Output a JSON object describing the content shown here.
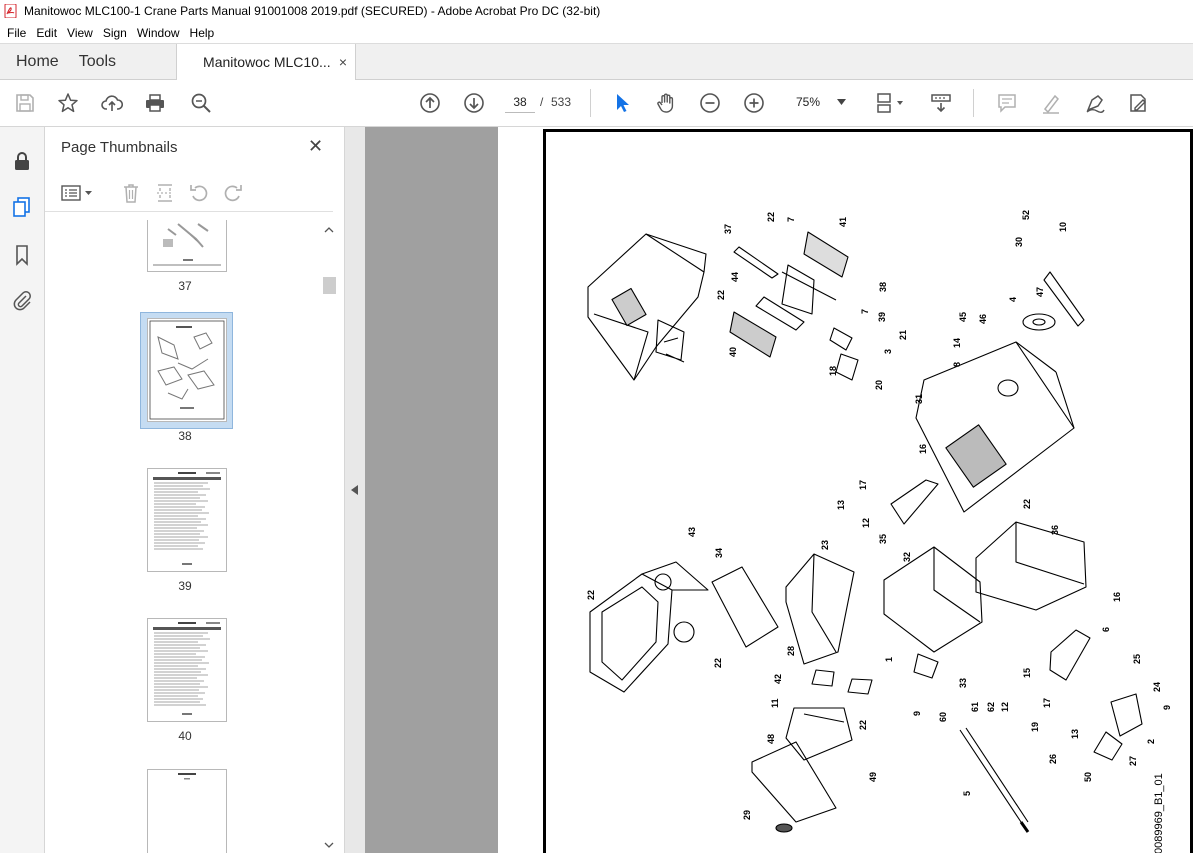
{
  "window": {
    "title": "Manitowoc MLC100-1 Crane Parts Manual 91001008 2019.pdf (SECURED) - Adobe Acrobat Pro DC (32-bit)"
  },
  "menu": [
    "File",
    "Edit",
    "View",
    "Sign",
    "Window",
    "Help"
  ],
  "tabs": {
    "home": "Home",
    "tools": "Tools",
    "document": "Manitowoc MLC10...",
    "close_symbol": "×"
  },
  "toolbar": {
    "current_page": "38",
    "page_separator": "/",
    "total_pages": "533",
    "zoom": "75%"
  },
  "thumbnails": {
    "title": "Page Thumbnails",
    "close_symbol": "✕",
    "pages": [
      {
        "label": "37",
        "selected": false
      },
      {
        "label": "38",
        "selected": true
      },
      {
        "label": "39",
        "selected": false
      },
      {
        "label": "40",
        "selected": false
      },
      {
        "label": "",
        "selected": false
      }
    ]
  },
  "page": {
    "drawing_id": "0089969_B1_01",
    "callouts": [
      "37",
      "22",
      "7",
      "41",
      "52",
      "10",
      "30",
      "4",
      "47",
      "44",
      "38",
      "22",
      "7",
      "39",
      "21",
      "45",
      "46",
      "40",
      "18",
      "3",
      "20",
      "14",
      "8",
      "31",
      "16",
      "17",
      "13",
      "12",
      "35",
      "22",
      "36",
      "43",
      "34",
      "23",
      "32",
      "22",
      "22",
      "16",
      "6",
      "28",
      "42",
      "1",
      "33",
      "15",
      "25",
      "24",
      "11",
      "22",
      "9",
      "60",
      "61",
      "62",
      "12",
      "17",
      "13",
      "19",
      "9",
      "48",
      "49",
      "26",
      "50",
      "27",
      "2",
      "5",
      "29"
    ]
  },
  "colors": {
    "accent_blue": "#1473e6",
    "selection_blue": "#c5dcf2",
    "workspace_gray": "#a0a0a0",
    "pdf_red": "#d4262c"
  }
}
